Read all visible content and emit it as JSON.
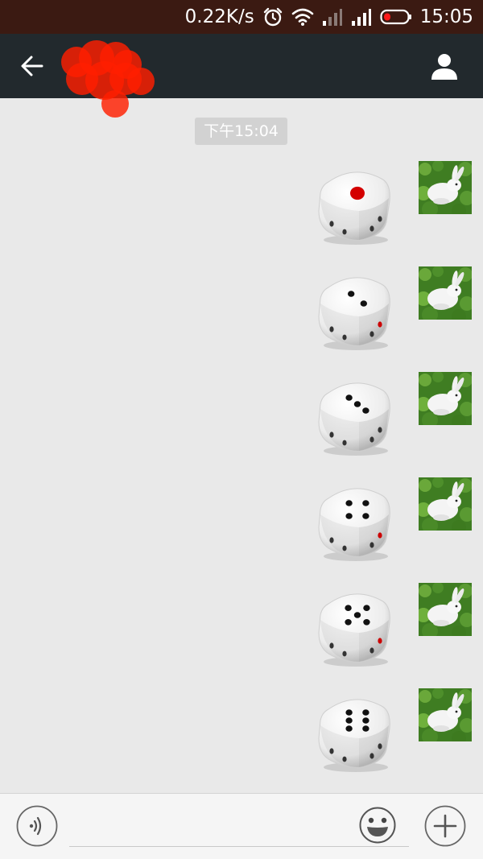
{
  "status_bar": {
    "network_speed": "0.22K/s",
    "time": "15:05",
    "icons": [
      "alarm-icon",
      "wifi-icon",
      "signal-icon-1",
      "signal-icon-2",
      "battery-icon"
    ],
    "battery_color": "#ff1a1a"
  },
  "title_bar": {
    "back_icon": "back-arrow-icon",
    "contact_name": "",
    "profile_icon": "person-icon",
    "background": "#22292d"
  },
  "chat": {
    "timestamp": "下午15:04",
    "messages": [
      {
        "type": "dice",
        "face": 1,
        "sender": "self",
        "avatar": "rabbit-avatar"
      },
      {
        "type": "dice",
        "face": 2,
        "sender": "self",
        "avatar": "rabbit-avatar"
      },
      {
        "type": "dice",
        "face": 3,
        "sender": "self",
        "avatar": "rabbit-avatar"
      },
      {
        "type": "dice",
        "face": 4,
        "sender": "self",
        "avatar": "rabbit-avatar"
      },
      {
        "type": "dice",
        "face": 5,
        "sender": "self",
        "avatar": "rabbit-avatar"
      },
      {
        "type": "dice",
        "face": 6,
        "sender": "self",
        "avatar": "rabbit-avatar"
      }
    ]
  },
  "input_bar": {
    "voice_icon": "voice-icon",
    "text_value": "",
    "emoji_icon": "emoji-icon",
    "plus_icon": "plus-icon"
  }
}
